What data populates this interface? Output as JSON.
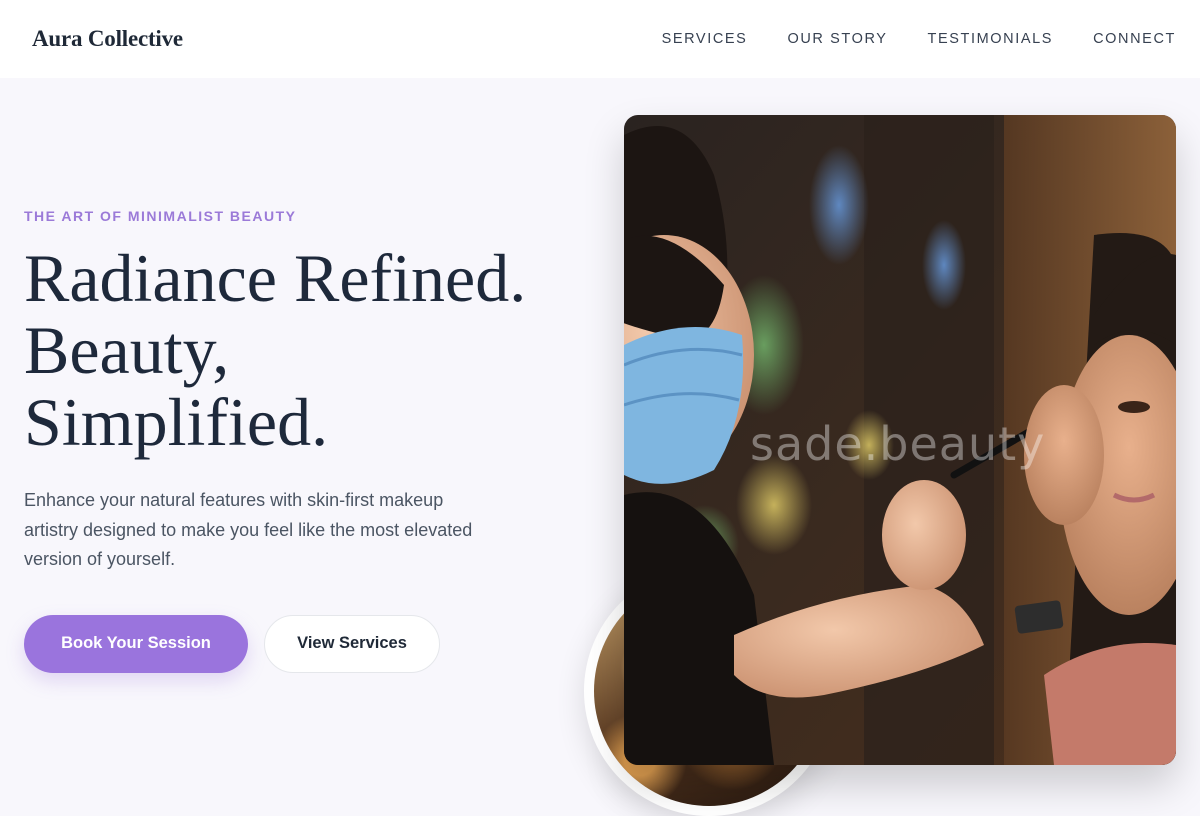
{
  "brand": {
    "name": "Aura Collective"
  },
  "nav": {
    "links": [
      {
        "label": "SERVICES"
      },
      {
        "label": "OUR STORY"
      },
      {
        "label": "TESTIMONIALS"
      },
      {
        "label": "CONNECT"
      }
    ]
  },
  "hero": {
    "eyebrow": "THE ART OF MINIMALIST BEAUTY",
    "headline_lines": [
      "Radiance Refined.",
      "Beauty,",
      "Simplified."
    ],
    "lede": "Enhance your natural features with skin-first makeup artistry designed to make you feel like the most elevated version of yourself.",
    "primary_cta": "Book Your Session",
    "secondary_cta": "View Services"
  },
  "photo": {
    "watermark": "sade.beauty"
  },
  "colors": {
    "accent": "#9a74dd",
    "eyebrow": "#9b7ad8",
    "heading": "#1e293b",
    "background": "#f8f7fc"
  }
}
